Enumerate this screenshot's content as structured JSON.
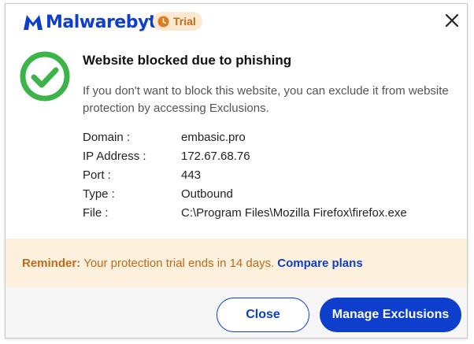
{
  "header": {
    "brand_name": "Malwarebytes",
    "trial_label": "Trial",
    "close_icon": "close-icon"
  },
  "colors": {
    "brand_blue": "#0d3ecc",
    "success_green": "#3cb44a",
    "trial_orange": "#c06a1a",
    "reminder_bg": "#fdf0dd"
  },
  "alert": {
    "title": "Website blocked due to phishing",
    "description": "If you don't want to block this website, you can exclude it from website protection by accessing Exclusions.",
    "status_icon": "check-circle-icon"
  },
  "details": [
    {
      "label": "Domain :",
      "value": "embasic.pro"
    },
    {
      "label": "IP Address :",
      "value": "172.67.68.76"
    },
    {
      "label": "Port :",
      "value": "443"
    },
    {
      "label": "Type :",
      "value": "Outbound"
    },
    {
      "label": "File :",
      "value": "C:\\Program Files\\Mozilla Firefox\\firefox.exe"
    }
  ],
  "reminder": {
    "label": "Reminder:",
    "text": "Your protection trial ends in 14 days.",
    "link": "Compare plans"
  },
  "footer": {
    "close_label": "Close",
    "manage_label": "Manage Exclusions"
  }
}
